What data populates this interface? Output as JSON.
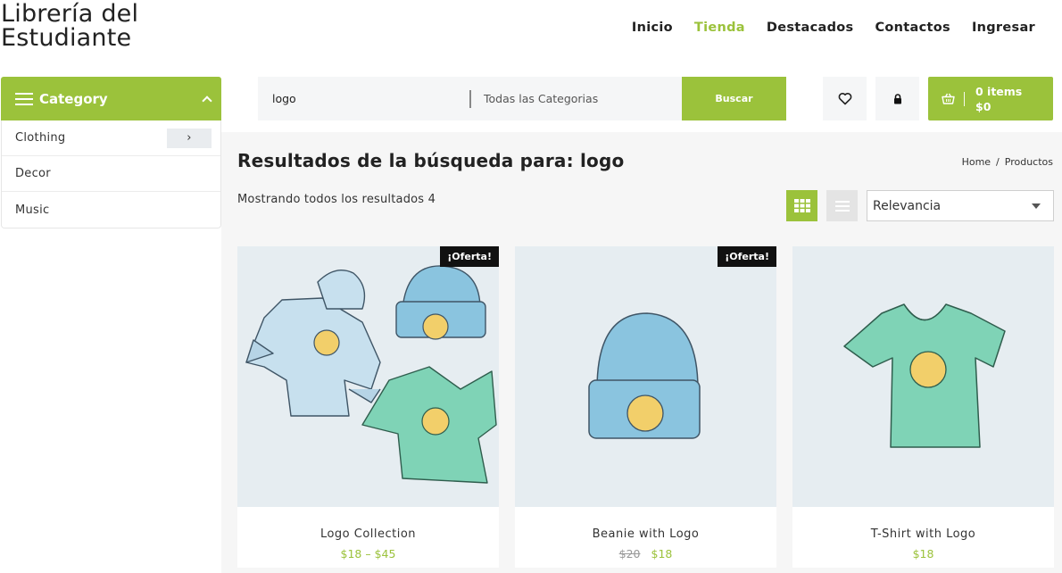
{
  "site": {
    "title_line1": "Librería del",
    "title_line2": "Estudiante"
  },
  "nav": [
    {
      "label": "Inicio",
      "active": false
    },
    {
      "label": "Tienda",
      "active": true
    },
    {
      "label": "Destacados",
      "active": false
    },
    {
      "label": "Contactos",
      "active": false
    },
    {
      "label": "Ingresar",
      "active": false
    }
  ],
  "category": {
    "header": "Category",
    "items": [
      {
        "label": "Clothing",
        "has_submenu": true
      },
      {
        "label": "Decor",
        "has_submenu": false
      },
      {
        "label": "Music",
        "has_submenu": false
      }
    ]
  },
  "search": {
    "query": "logo",
    "category_placeholder": "Todas las Categorias",
    "button": "Buscar"
  },
  "header_icons": {
    "wishlist": "heart-icon",
    "account": "lock-icon",
    "cart": "basket-icon"
  },
  "cart": {
    "items": "0 items",
    "total": "$0"
  },
  "results": {
    "title": "Resultados de la búsqueda para: logo",
    "breadcrumb": [
      "Home",
      "/",
      "Productos"
    ],
    "count_text": "Mostrando todos los resultados 4",
    "sort": "Relevancia"
  },
  "products": [
    {
      "name": "Logo Collection",
      "price": "$18 – $45",
      "old_price": "",
      "badge": "¡Oferta!"
    },
    {
      "name": "Beanie with Logo",
      "price": "$18",
      "old_price": "$20",
      "badge": "¡Oferta!"
    },
    {
      "name": "T-Shirt with Logo",
      "price": "$18",
      "old_price": "",
      "badge": ""
    }
  ],
  "colors": {
    "accent": "#9bc23b",
    "badge_bg": "#111111",
    "panel_bg": "#f6f6f6"
  }
}
